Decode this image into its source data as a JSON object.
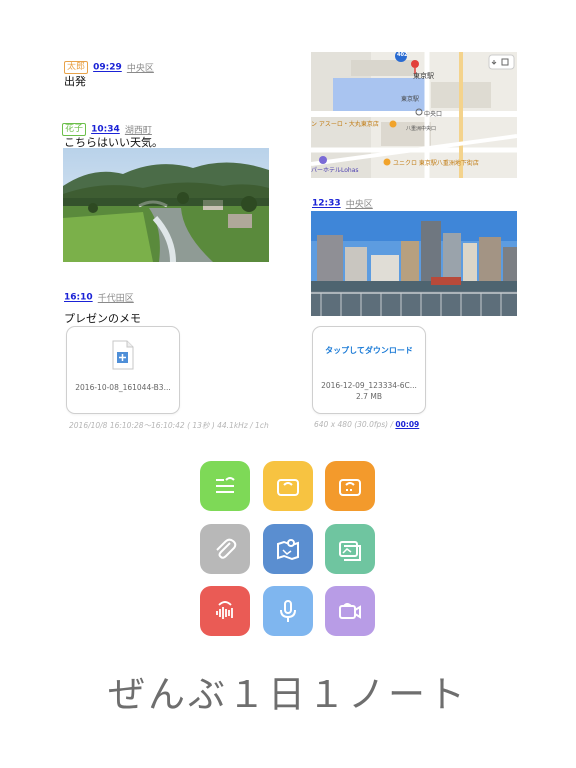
{
  "entries": {
    "e1": {
      "name": "太郎",
      "name_color": "#e8a34a",
      "time": "09:29",
      "place": "中央区",
      "text": "出発"
    },
    "e2": {
      "name": "花子",
      "name_color": "#6cbf4a",
      "time": "10:34",
      "place": "湖西町",
      "text": "こちらはいい天気。"
    },
    "e3": {
      "time": "16:10",
      "place": "千代田区",
      "text": "プレゼンのメモ",
      "file": {
        "name": "2016-10-08_161044-B3..."
      },
      "caption": "2016/10/8 16:10:28〜16:10:42 ( 13秒 ) 44.1kHz / 1ch"
    },
    "e4": {
      "time": "12:33",
      "place": "中央区"
    },
    "e5": {
      "file": {
        "action": "タップしてダウンロード",
        "name": "2016-12-09_123334-6C...",
        "size": "2.7 MB"
      },
      "caption_prefix": "640 x 480 (30.0fps) /",
      "duration": "00:09"
    }
  },
  "map": {
    "labels": {
      "station": "東京駅",
      "station_small": "東京駅",
      "daimaru": "ン アスーロ・大丸東京店",
      "chuo_exit": "中央口",
      "yaesu_north": "八重洲中央口",
      "uniqlo": "ユニクロ 東京駅八重洲地下街店",
      "hotel": "パーホテルLohas",
      "badge": "402"
    }
  },
  "icons": [
    {
      "name": "note-icon",
      "color": "#7ed957"
    },
    {
      "name": "camera-icon",
      "color": "#f7c341"
    },
    {
      "name": "photo-camera-icon",
      "color": "#f39a2c"
    },
    {
      "name": "attachment-icon",
      "color": "#b8b8b8"
    },
    {
      "name": "map-icon",
      "color": "#5a8ed0"
    },
    {
      "name": "photos-icon",
      "color": "#6fc5a0"
    },
    {
      "name": "audio-recorder-icon",
      "color": "#ea5b55"
    },
    {
      "name": "microphone-icon",
      "color": "#7fb6ef"
    },
    {
      "name": "video-camera-icon",
      "color": "#b89ce6"
    }
  ],
  "tagline": "ぜんぶ１日１ノート"
}
